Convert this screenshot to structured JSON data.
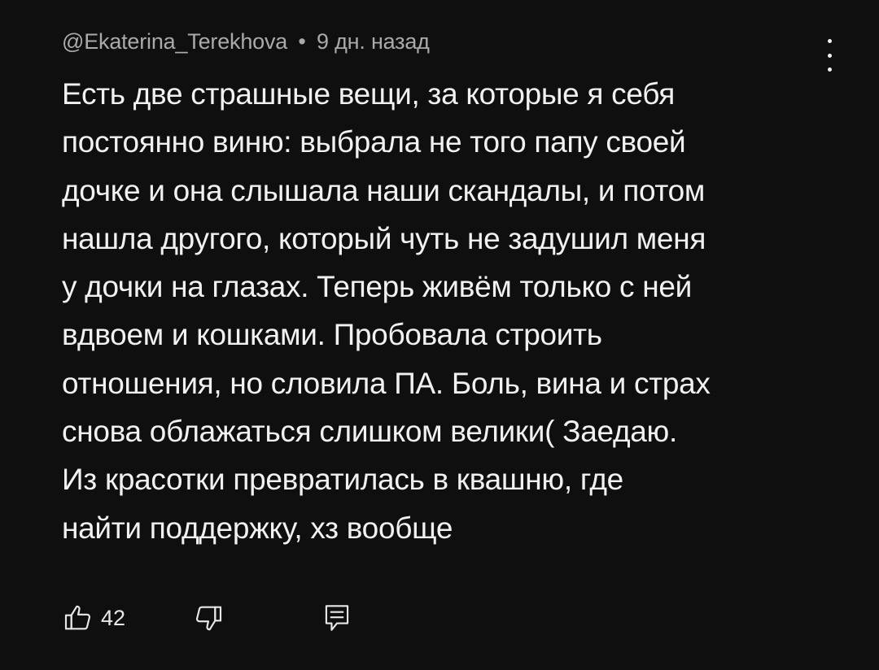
{
  "comment": {
    "author": "@Ekaterina_Terekhova",
    "separator": "•",
    "time_ago": "9 дн. назад",
    "text": "Есть две страшные вещи, за которые я себя\nпостоянно виню: выбрала не того папу своей\nдочке и она слышала наши скандалы, и потом\nнашла другого, который чуть не задушил меня\nу дочки на глазах.  Теперь живём только с ней\nвдвоем и кошками. Пробовала строить\nотношения, но словила ПА. Боль, вина и страх\nснова облажаться слишком велики( Заедаю.\nИз красотки превратилась в квашню, где\nнайти поддержку, хз вообще",
    "like_count": "42"
  },
  "icons": {
    "more": "more-vertical-icon",
    "like": "thumbs-up-icon",
    "dislike": "thumbs-down-icon",
    "reply": "reply-comment-icon"
  },
  "colors": {
    "background": "#0f0f0f",
    "text": "#f1f1f1",
    "secondary_text": "#aaaaaa"
  }
}
